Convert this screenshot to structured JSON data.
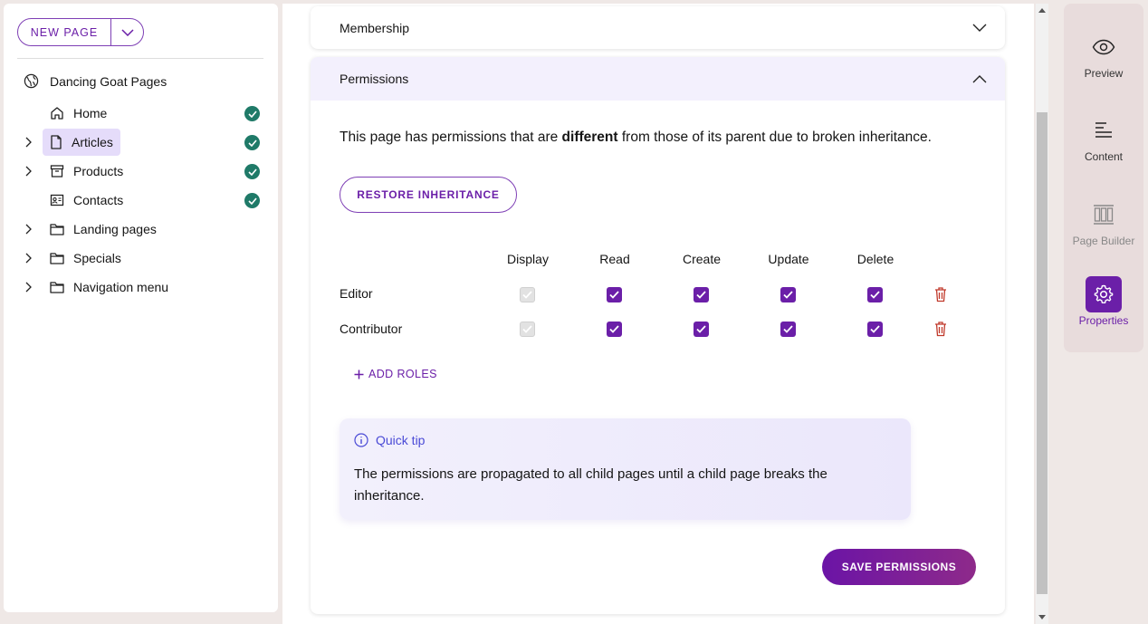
{
  "sidebar": {
    "new_page_label": "NEW PAGE",
    "tree": {
      "root_label": "Dancing Goat Pages",
      "items": [
        {
          "label": "Home",
          "icon": "home-icon",
          "expandable": false,
          "selected": false,
          "published": true
        },
        {
          "label": "Articles",
          "icon": "file-icon",
          "expandable": true,
          "selected": true,
          "published": true
        },
        {
          "label": "Products",
          "icon": "archive-icon",
          "expandable": true,
          "selected": false,
          "published": true
        },
        {
          "label": "Contacts",
          "icon": "contact-card-icon",
          "expandable": false,
          "selected": false,
          "published": true
        },
        {
          "label": "Landing pages",
          "icon": "folder-icon",
          "expandable": true,
          "selected": false,
          "published": false
        },
        {
          "label": "Specials",
          "icon": "folder-icon",
          "expandable": true,
          "selected": false,
          "published": false
        },
        {
          "label": "Navigation menu",
          "icon": "folder-icon",
          "expandable": true,
          "selected": false,
          "published": false
        }
      ]
    }
  },
  "membership": {
    "title": "Membership"
  },
  "permissions": {
    "title": "Permissions",
    "desc_pre": "This page has permissions that are ",
    "desc_bold": "different",
    "desc_post": " from those of its parent due to broken inheritance.",
    "restore_label": "RESTORE INHERITANCE",
    "columns": [
      "Display",
      "Read",
      "Create",
      "Update",
      "Delete"
    ],
    "roles": [
      {
        "name": "Editor",
        "display": true,
        "read": true,
        "create": true,
        "update": true,
        "delete": true,
        "display_disabled": true
      },
      {
        "name": "Contributor",
        "display": true,
        "read": true,
        "create": true,
        "update": true,
        "delete": true,
        "display_disabled": true
      }
    ],
    "add_roles_label": "ADD ROLES",
    "tip": {
      "title": "Quick tip",
      "text": "The permissions are propagated to all child pages until a child page breaks the inheritance."
    },
    "save_label": "SAVE PERMISSIONS"
  },
  "rail": {
    "items": [
      {
        "label": "Preview",
        "icon": "eye-icon",
        "state": "normal"
      },
      {
        "label": "Content",
        "icon": "text-align-icon",
        "state": "normal"
      },
      {
        "label": "Page Builder",
        "icon": "page-builder-icon",
        "state": "disabled"
      },
      {
        "label": "Properties",
        "icon": "cog-icon",
        "state": "active"
      }
    ]
  },
  "colors": {
    "accent": "#6b1fa8",
    "status_green": "#1f7a68",
    "selected_bg": "#e5dcfa",
    "danger": "#c0392b",
    "tip_title": "#4a4ad6"
  }
}
